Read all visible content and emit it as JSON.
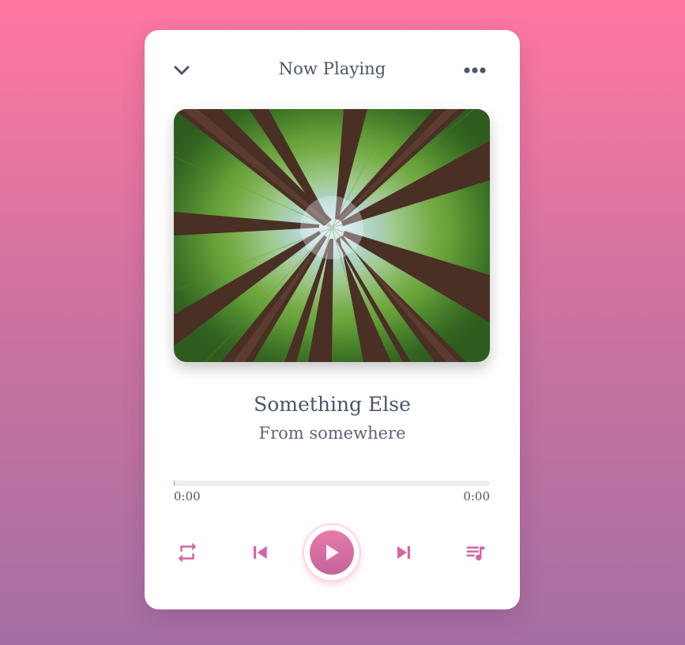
{
  "header": {
    "title": "Now Playing",
    "back_icon": "chevron-down-icon",
    "menu_icon": "more-horizontal-icon"
  },
  "track": {
    "name": "Something Else",
    "artist": "From somewhere",
    "cover_alt": "forest-canopy-photo"
  },
  "progress": {
    "current_time": "0:00",
    "duration": "0:00",
    "fraction": 0.0
  },
  "controls": {
    "repeat_icon": "repeat-icon",
    "prev_icon": "skip-previous-icon",
    "play_icon": "play-icon",
    "next_icon": "skip-next-icon",
    "queue_icon": "playlist-music-icon"
  },
  "colors": {
    "accent": "#e8679d",
    "accent_dark": "#c1649f",
    "text": "#4a5568",
    "background_top": "#ff77a1",
    "background_bottom": "#a56fa3"
  }
}
